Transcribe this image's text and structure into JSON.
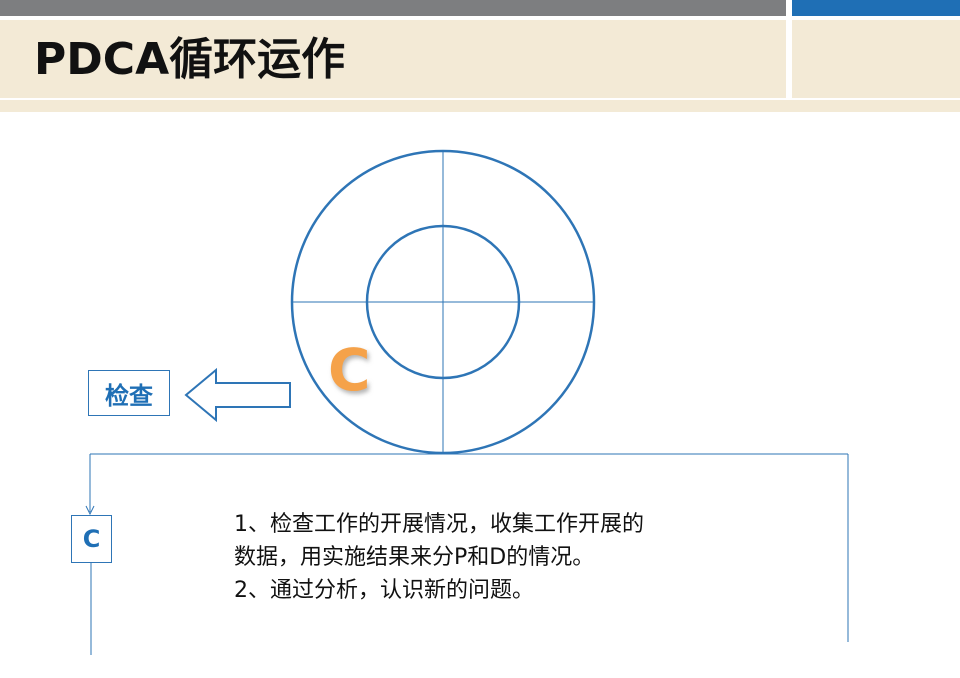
{
  "header": {
    "title": "PDCA循环运作"
  },
  "diagram": {
    "center_letter": "C",
    "check_label": "检查",
    "stage_label": "C",
    "description_lines": [
      "1、检查工作的开展情况，收集工作开展的",
      "数据，用实施结果来分P和D的情况。",
      "2、通过分析，认识新的问题。"
    ]
  },
  "colors": {
    "circle_stroke": "#2e75b6",
    "accent_orange": "#f5a24a",
    "label_blue": "#1f6fb5",
    "header_band": "#f3ead6",
    "strip_gray": "#7d7e80",
    "strip_blue": "#1f6fb5"
  }
}
